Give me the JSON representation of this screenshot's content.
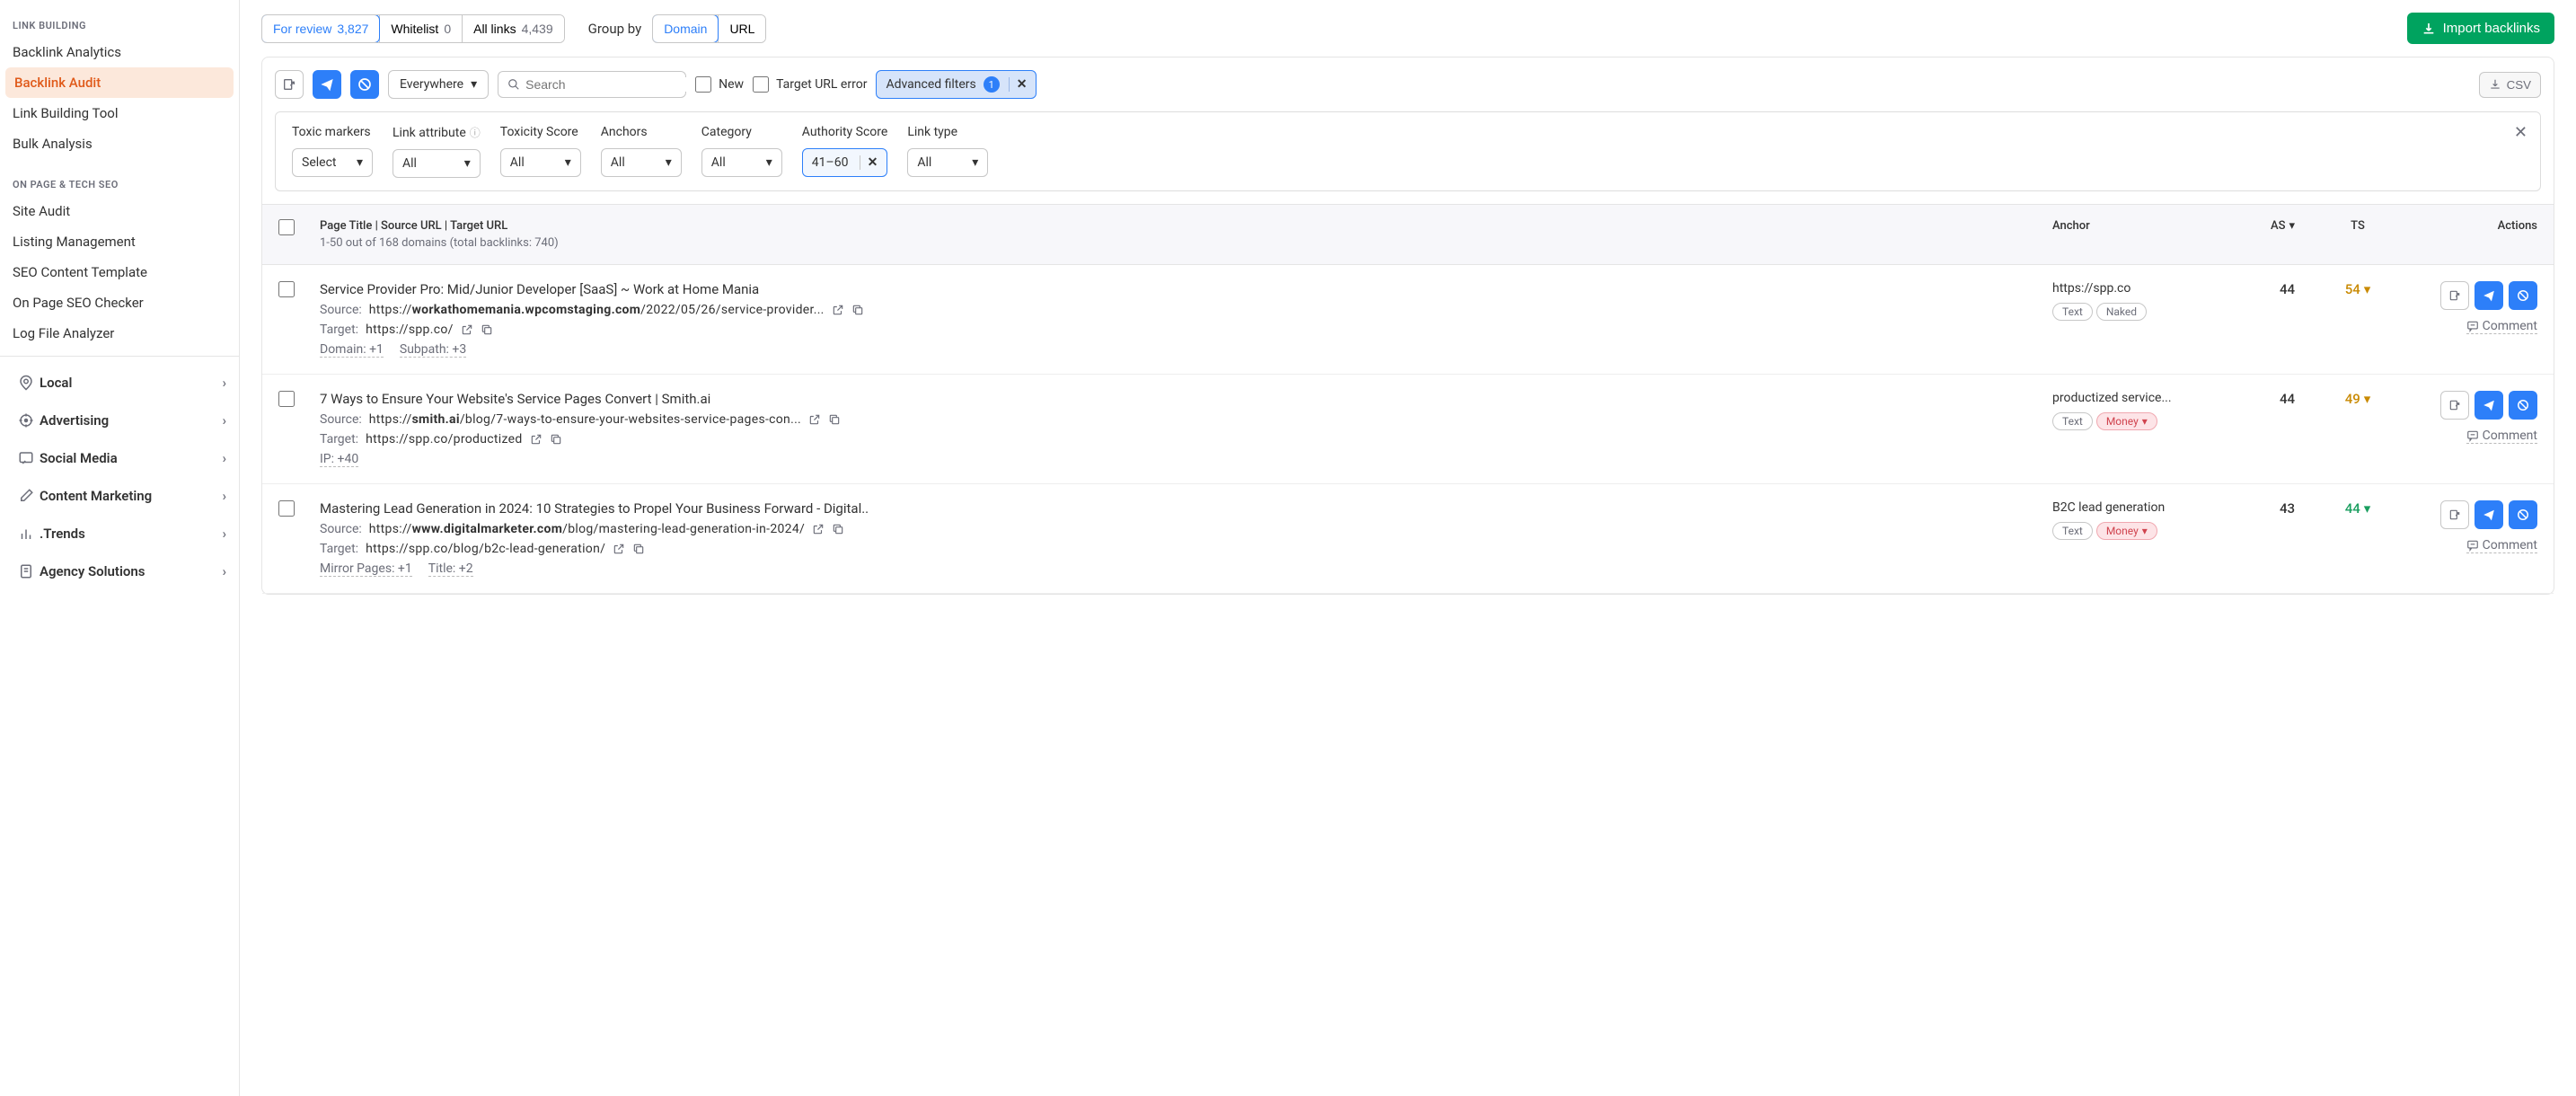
{
  "sidebar": {
    "section1_label": "LINK BUILDING",
    "items1": [
      "Backlink Analytics",
      "Backlink Audit",
      "Link Building Tool",
      "Bulk Analysis"
    ],
    "active_index": 1,
    "section2_label": "ON PAGE & TECH SEO",
    "items2": [
      "Site Audit",
      "Listing Management",
      "SEO Content Template",
      "On Page SEO Checker",
      "Log File Analyzer"
    ],
    "categories": [
      "Local",
      "Advertising",
      "Social Media",
      "Content Marketing",
      ".Trends",
      "Agency Solutions"
    ]
  },
  "topbar": {
    "tabs": [
      {
        "label": "For review",
        "count": "3,827"
      },
      {
        "label": "Whitelist",
        "count": "0"
      },
      {
        "label": "All links",
        "count": "4,439"
      }
    ],
    "group_by_label": "Group by",
    "group_options": [
      "Domain",
      "URL"
    ],
    "import_label": "Import backlinks"
  },
  "toolbar": {
    "scope": "Everywhere",
    "search_placeholder": "Search",
    "new_label": "New",
    "target_error_label": "Target URL error",
    "adv_filters_label": "Advanced filters",
    "adv_filters_count": "1",
    "csv_label": "CSV"
  },
  "filters": {
    "cols": [
      {
        "label": "Toxic markers",
        "value": "Select"
      },
      {
        "label": "Link attribute",
        "value": "All",
        "info": true
      },
      {
        "label": "Toxicity Score",
        "value": "All"
      },
      {
        "label": "Anchors",
        "value": "All"
      },
      {
        "label": "Category",
        "value": "All"
      },
      {
        "label": "Authority Score",
        "value": "41–60",
        "active": true,
        "clearable": true
      },
      {
        "label": "Link type",
        "value": "All"
      }
    ]
  },
  "table": {
    "header": {
      "title": "Page Title | Source URL | Target URL",
      "sub": "1-50 out of 168 domains (total backlinks: 740)",
      "anchor": "Anchor",
      "as": "AS",
      "ts": "TS",
      "actions": "Actions"
    },
    "rows": [
      {
        "title": "Service Provider Pro: Mid/Junior Developer [SaaS] ~ Work at Home Mania",
        "source_prefix": "https://",
        "source_bold": "workathomemania.wpcomstaging.com",
        "source_rest": "/2022/05/26/service-provider...",
        "target": "https://spp.co/",
        "meta": [
          "Domain: +1",
          "Subpath: +3"
        ],
        "anchor": "https://spp.co",
        "tags": [
          {
            "t": "Text"
          },
          {
            "t": "Naked"
          }
        ],
        "as": "44",
        "ts": "54",
        "ts_class": "ts-orange"
      },
      {
        "title": "7 Ways to Ensure Your Website's Service Pages Convert | Smith.ai",
        "source_prefix": "https://",
        "source_bold": "smith.ai",
        "source_rest": "/blog/7-ways-to-ensure-your-websites-service-pages-con...",
        "target": "https://spp.co/productized",
        "meta": [
          "IP: +40"
        ],
        "anchor": "productized service...",
        "tags": [
          {
            "t": "Text"
          },
          {
            "t": "Money",
            "money": true
          }
        ],
        "as": "44",
        "ts": "49",
        "ts_class": "ts-orange"
      },
      {
        "title": "Mastering Lead Generation in 2024: 10 Strategies to Propel Your Business Forward - Digital..",
        "source_prefix": "https://",
        "source_bold": "www.digitalmarketer.com",
        "source_rest": "/blog/mastering-lead-generation-in-2024/",
        "target": "https://spp.co/blog/b2c-lead-generation/",
        "meta": [
          "Mirror Pages: +1",
          "Title: +2"
        ],
        "anchor": "B2C lead generation",
        "tags": [
          {
            "t": "Text"
          },
          {
            "t": "Money",
            "money": true
          }
        ],
        "as": "43",
        "ts": "44",
        "ts_class": "ts-green"
      }
    ],
    "comment_label": "Comment"
  }
}
